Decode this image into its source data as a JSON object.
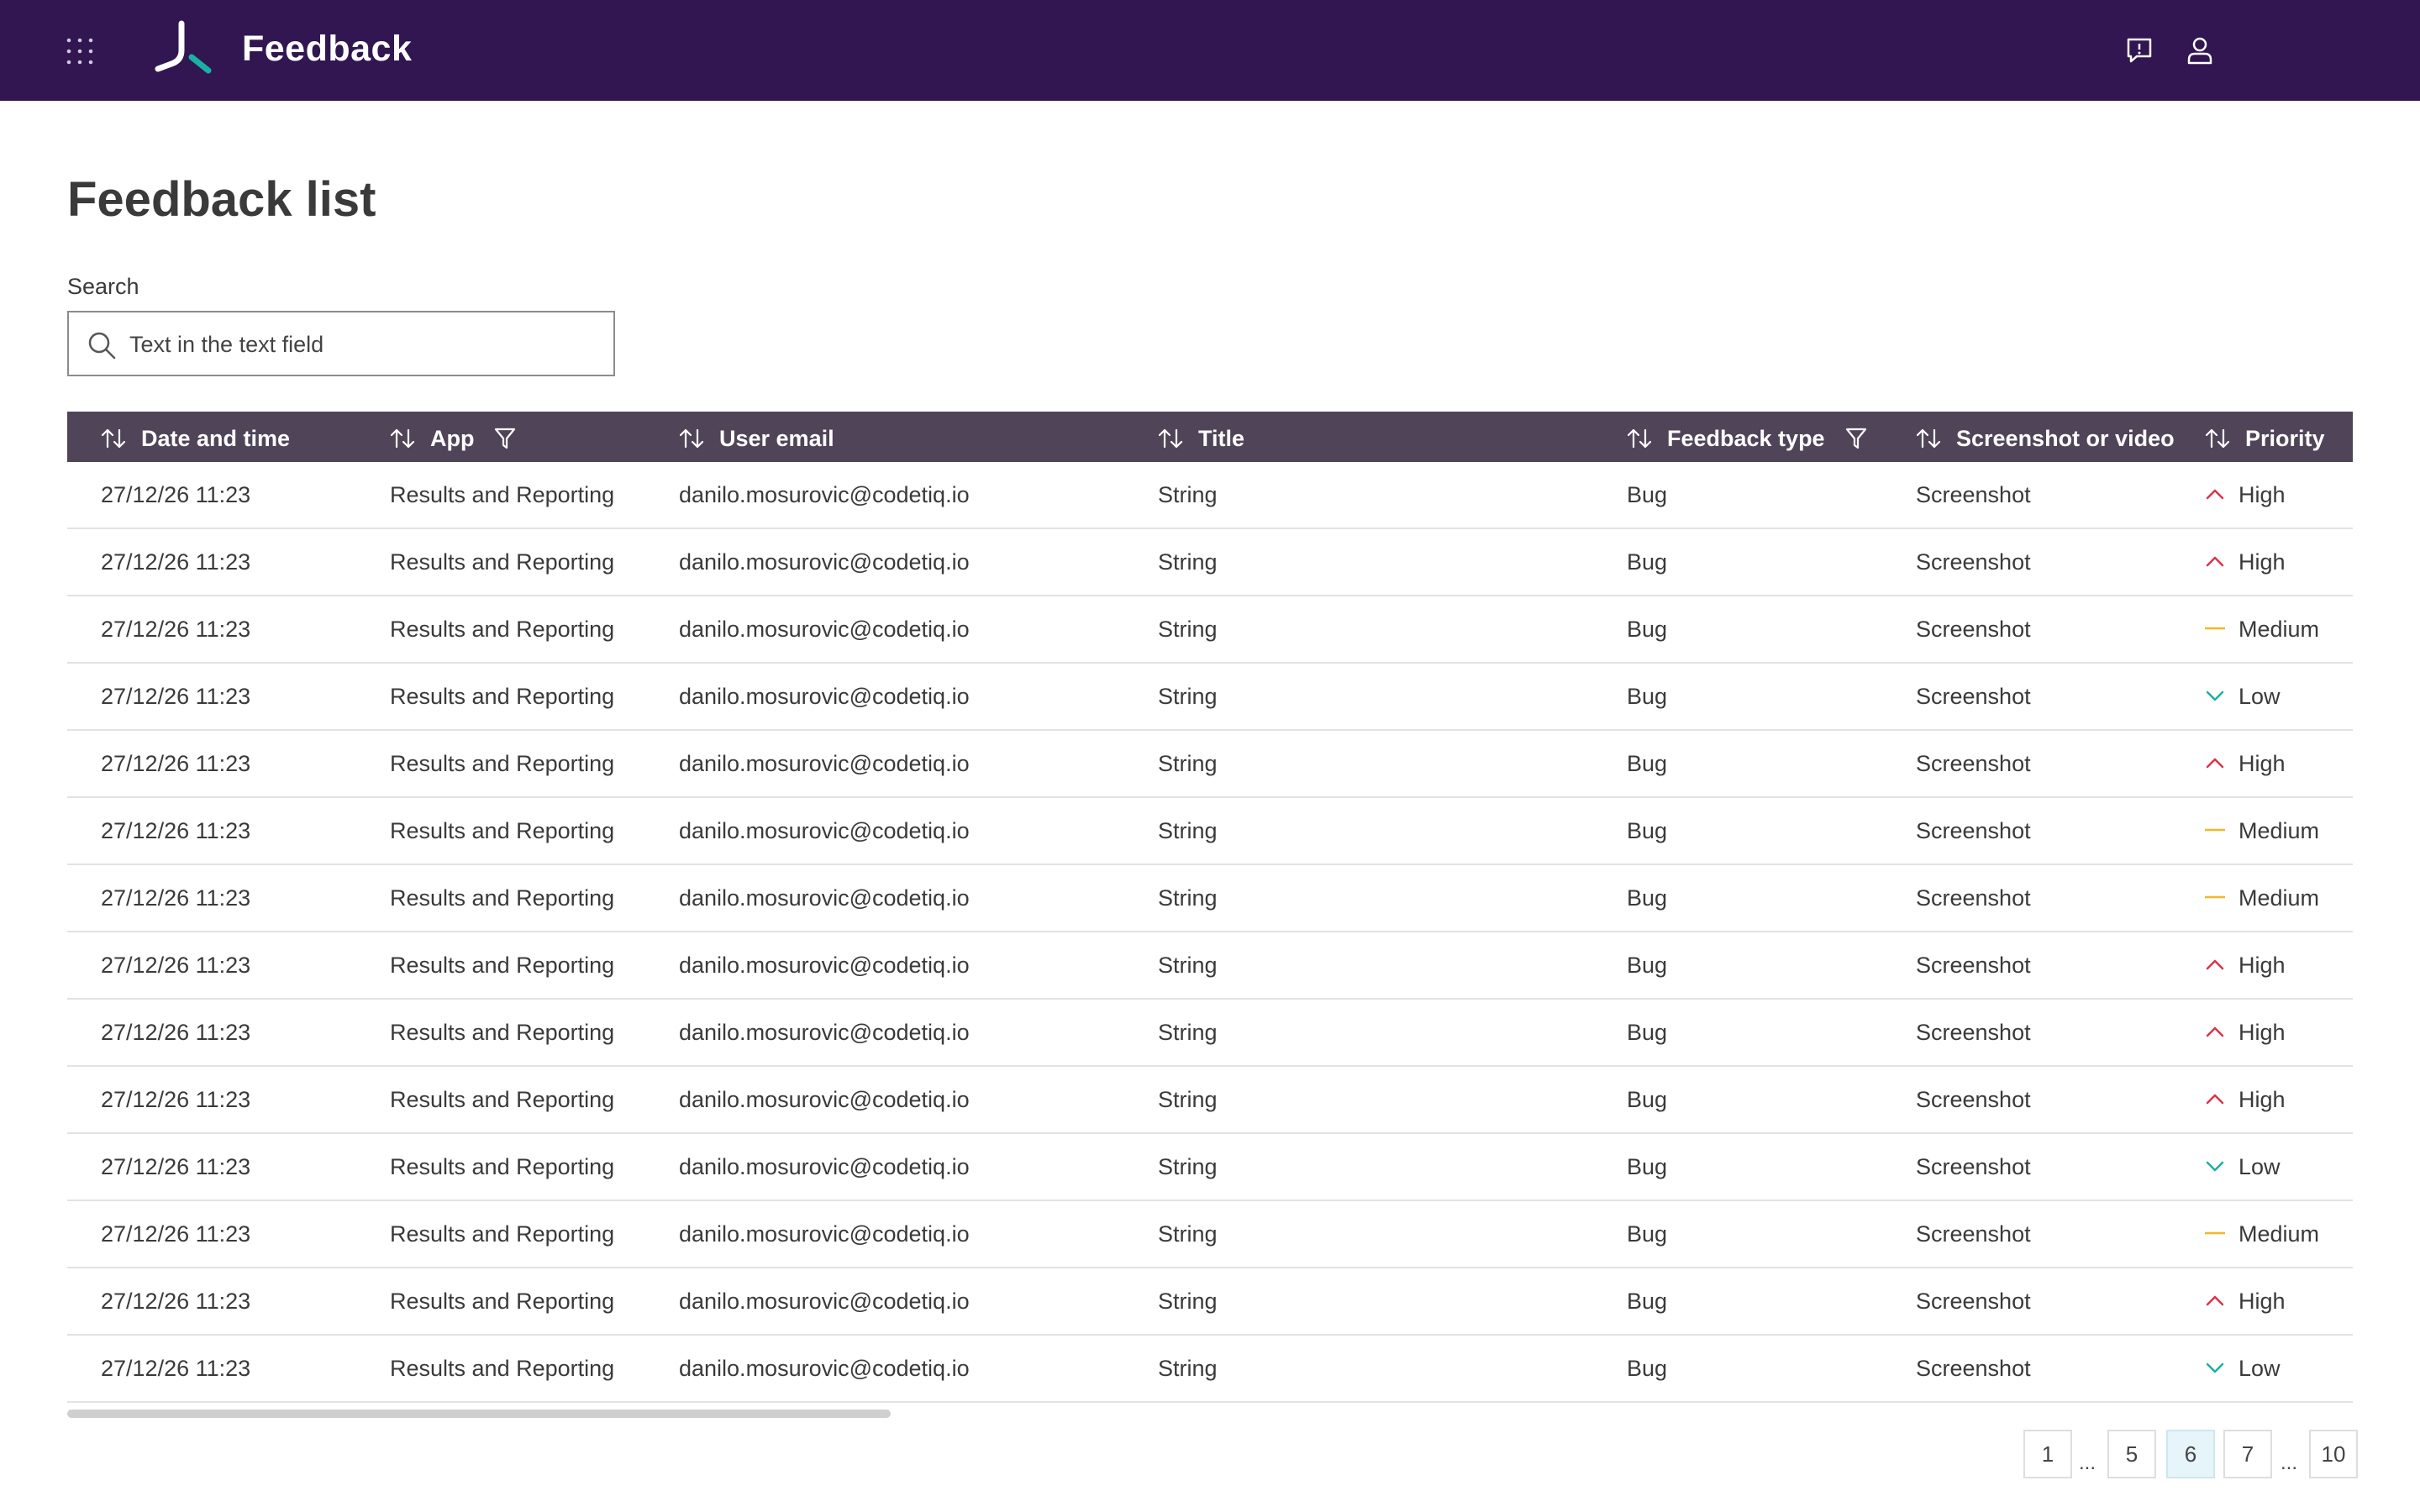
{
  "header": {
    "app_name": "Feedback",
    "icons": [
      "apps-grid-icon",
      "app-logo",
      "feedback-icon",
      "user-icon"
    ],
    "background": "#311651",
    "logo_colors": [
      "#ffffff",
      "#1bb0a4"
    ]
  },
  "page": {
    "title": "Feedback list"
  },
  "search": {
    "label": "Search",
    "value": "Text in the text field",
    "placeholder": ""
  },
  "table": {
    "header_background": "#4f4458",
    "columns": [
      {
        "key": "date",
        "label": "Date and time",
        "sortable": true,
        "filterable": false
      },
      {
        "key": "app",
        "label": "App",
        "sortable": true,
        "filterable": true
      },
      {
        "key": "email",
        "label": "User email",
        "sortable": true,
        "filterable": false
      },
      {
        "key": "title",
        "label": "Title",
        "sortable": true,
        "filterable": false
      },
      {
        "key": "type",
        "label": "Feedback type",
        "sortable": true,
        "filterable": true
      },
      {
        "key": "media",
        "label": "Screenshot or video",
        "sortable": true,
        "filterable": false
      },
      {
        "key": "priority",
        "label": "Priority",
        "sortable": true,
        "filterable": false
      }
    ],
    "priority_styles": {
      "High": {
        "icon": "chevron-up-icon",
        "color": "#d9344a"
      },
      "Medium": {
        "icon": "dash-icon",
        "color": "#f2b824"
      },
      "Low": {
        "icon": "chevron-down-icon",
        "color": "#1bb0a4"
      }
    },
    "rows": [
      {
        "date": "27/12/26 11:23",
        "app": "Results and Reporting",
        "email": "danilo.mosurovic@codetiq.io",
        "title": "String",
        "type": "Bug",
        "media": "Screenshot",
        "priority": "High"
      },
      {
        "date": "27/12/26 11:23",
        "app": "Results and Reporting",
        "email": "danilo.mosurovic@codetiq.io",
        "title": "String",
        "type": "Bug",
        "media": "Screenshot",
        "priority": "High"
      },
      {
        "date": "27/12/26 11:23",
        "app": "Results and Reporting",
        "email": "danilo.mosurovic@codetiq.io",
        "title": "String",
        "type": "Bug",
        "media": "Screenshot",
        "priority": "Medium"
      },
      {
        "date": "27/12/26 11:23",
        "app": "Results and Reporting",
        "email": "danilo.mosurovic@codetiq.io",
        "title": "String",
        "type": "Bug",
        "media": "Screenshot",
        "priority": "Low"
      },
      {
        "date": "27/12/26 11:23",
        "app": "Results and Reporting",
        "email": "danilo.mosurovic@codetiq.io",
        "title": "String",
        "type": "Bug",
        "media": "Screenshot",
        "priority": "High"
      },
      {
        "date": "27/12/26 11:23",
        "app": "Results and Reporting",
        "email": "danilo.mosurovic@codetiq.io",
        "title": "String",
        "type": "Bug",
        "media": "Screenshot",
        "priority": "Medium"
      },
      {
        "date": "27/12/26 11:23",
        "app": "Results and Reporting",
        "email": "danilo.mosurovic@codetiq.io",
        "title": "String",
        "type": "Bug",
        "media": "Screenshot",
        "priority": "Medium"
      },
      {
        "date": "27/12/26 11:23",
        "app": "Results and Reporting",
        "email": "danilo.mosurovic@codetiq.io",
        "title": "String",
        "type": "Bug",
        "media": "Screenshot",
        "priority": "High"
      },
      {
        "date": "27/12/26 11:23",
        "app": "Results and Reporting",
        "email": "danilo.mosurovic@codetiq.io",
        "title": "String",
        "type": "Bug",
        "media": "Screenshot",
        "priority": "High"
      },
      {
        "date": "27/12/26 11:23",
        "app": "Results and Reporting",
        "email": "danilo.mosurovic@codetiq.io",
        "title": "String",
        "type": "Bug",
        "media": "Screenshot",
        "priority": "High"
      },
      {
        "date": "27/12/26 11:23",
        "app": "Results and Reporting",
        "email": "danilo.mosurovic@codetiq.io",
        "title": "String",
        "type": "Bug",
        "media": "Screenshot",
        "priority": "Low"
      },
      {
        "date": "27/12/26 11:23",
        "app": "Results and Reporting",
        "email": "danilo.mosurovic@codetiq.io",
        "title": "String",
        "type": "Bug",
        "media": "Screenshot",
        "priority": "Medium"
      },
      {
        "date": "27/12/26 11:23",
        "app": "Results and Reporting",
        "email": "danilo.mosurovic@codetiq.io",
        "title": "String",
        "type": "Bug",
        "media": "Screenshot",
        "priority": "High"
      },
      {
        "date": "27/12/26 11:23",
        "app": "Results and Reporting",
        "email": "danilo.mosurovic@codetiq.io",
        "title": "String",
        "type": "Bug",
        "media": "Screenshot",
        "priority": "Low"
      }
    ]
  },
  "pagination": {
    "items": [
      "1",
      "...",
      "5",
      "6",
      "7",
      "...",
      "10"
    ],
    "current": "6",
    "active_color": "#e6f5fa"
  }
}
